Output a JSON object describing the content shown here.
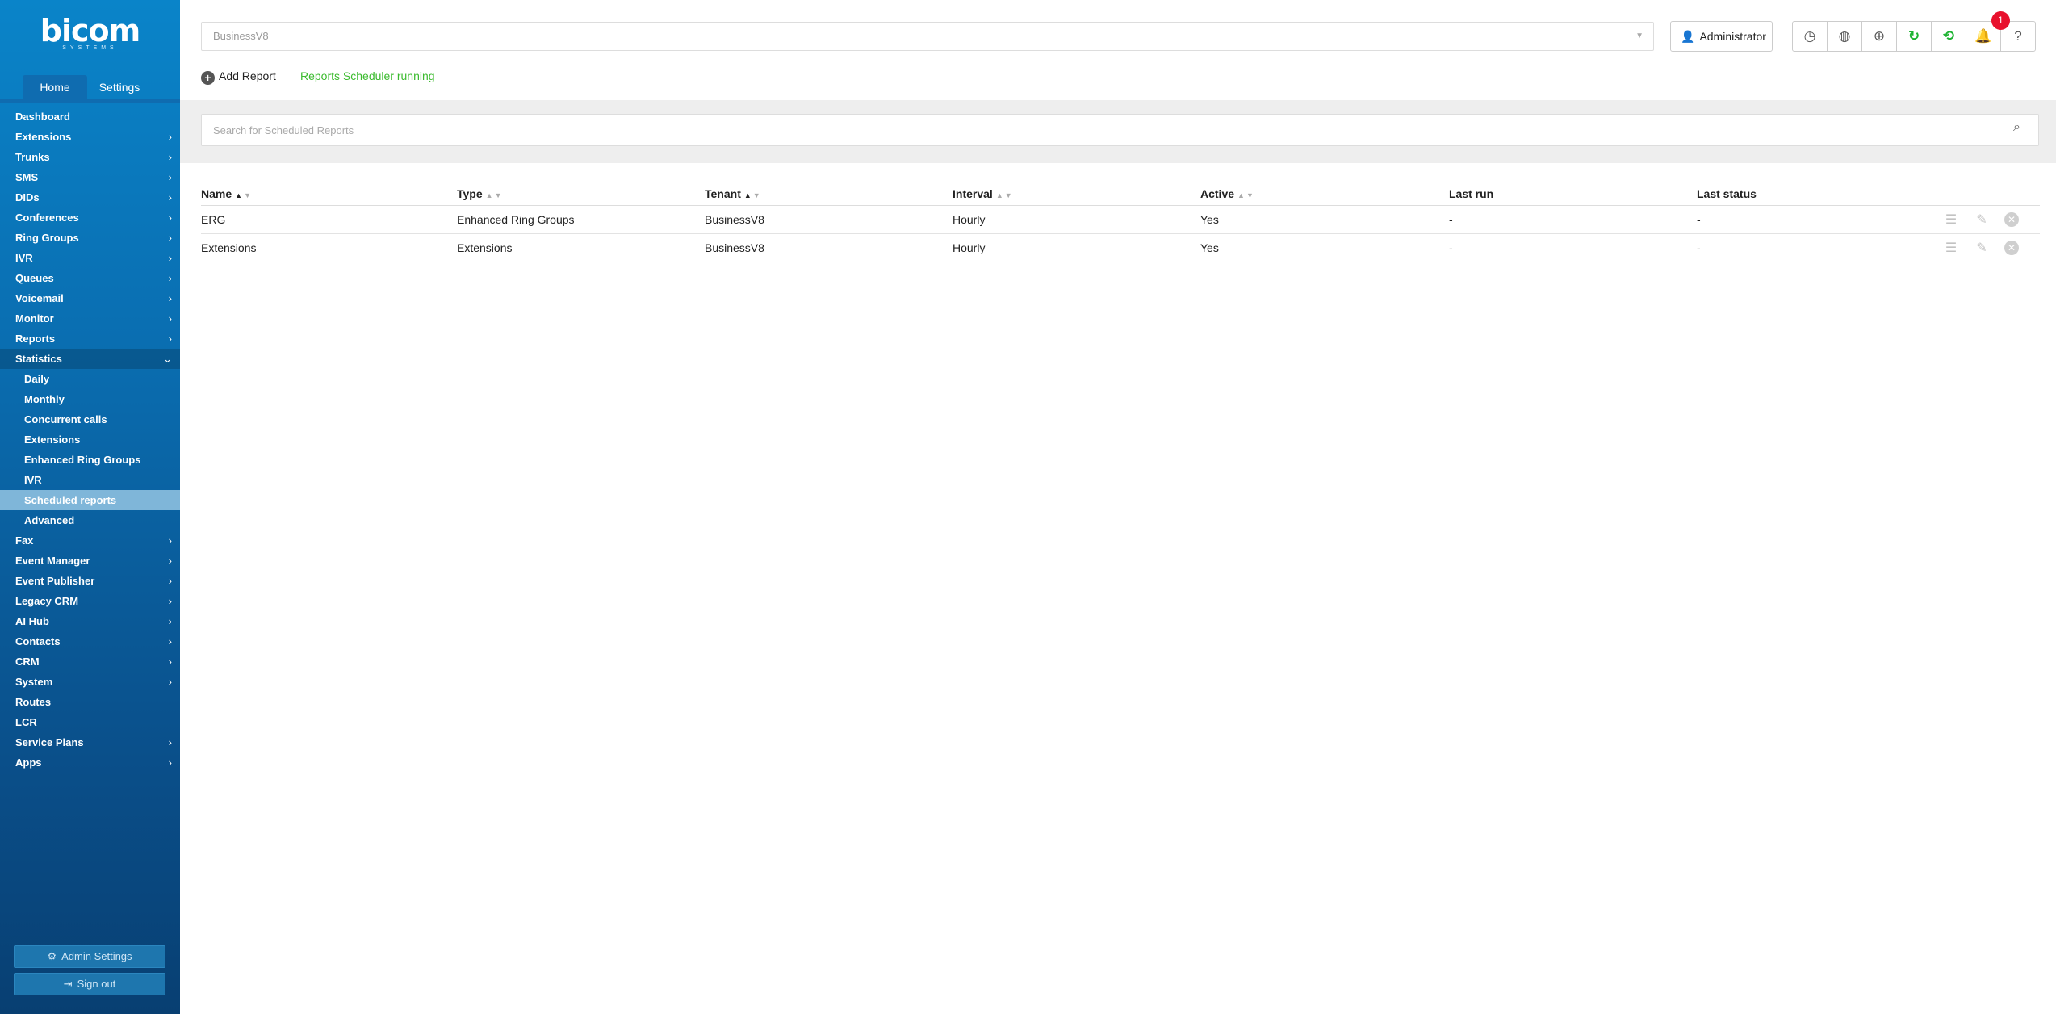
{
  "brand": {
    "name": "bicom",
    "sub": "SYSTEMS"
  },
  "sidebar": {
    "tabs": [
      {
        "label": "Home",
        "active": true
      },
      {
        "label": "Settings",
        "active": false
      }
    ],
    "menu": [
      {
        "label": "Dashboard",
        "has_children": false
      },
      {
        "label": "Extensions",
        "has_children": true
      },
      {
        "label": "Trunks",
        "has_children": true
      },
      {
        "label": "SMS",
        "has_children": true
      },
      {
        "label": "DIDs",
        "has_children": true
      },
      {
        "label": "Conferences",
        "has_children": true
      },
      {
        "label": "Ring Groups",
        "has_children": true
      },
      {
        "label": "IVR",
        "has_children": true
      },
      {
        "label": "Queues",
        "has_children": true
      },
      {
        "label": "Voicemail",
        "has_children": true
      },
      {
        "label": "Monitor",
        "has_children": true
      },
      {
        "label": "Reports",
        "has_children": true
      },
      {
        "label": "Statistics",
        "has_children": true,
        "open": true,
        "children": [
          {
            "label": "Daily"
          },
          {
            "label": "Monthly"
          },
          {
            "label": "Concurrent calls"
          },
          {
            "label": "Extensions"
          },
          {
            "label": "Enhanced Ring Groups"
          },
          {
            "label": "IVR"
          },
          {
            "label": "Scheduled reports",
            "active": true
          },
          {
            "label": "Advanced"
          }
        ]
      },
      {
        "label": "Fax",
        "has_children": true
      },
      {
        "label": "Event Manager",
        "has_children": true
      },
      {
        "label": "Event Publisher",
        "has_children": true
      },
      {
        "label": "Legacy CRM",
        "has_children": true
      },
      {
        "label": "AI Hub",
        "has_children": true
      },
      {
        "label": "Contacts",
        "has_children": true
      },
      {
        "label": "CRM",
        "has_children": true
      },
      {
        "label": "System",
        "has_children": true
      },
      {
        "label": "Routes",
        "has_children": false
      },
      {
        "label": "LCR",
        "has_children": false
      },
      {
        "label": "Service Plans",
        "has_children": true
      },
      {
        "label": "Apps",
        "has_children": true
      }
    ],
    "admin_settings_label": "Admin Settings",
    "sign_out_label": "Sign out"
  },
  "header": {
    "tenant_value": "BusinessV8",
    "user_label": "Administrator",
    "notification_count": "1",
    "icons": [
      "clock-icon",
      "globe-icon",
      "language-icon",
      "refresh-icon",
      "sync-icon",
      "bell-icon",
      "help-icon"
    ]
  },
  "actions": {
    "add_report_label": "Add Report",
    "scheduler_status": "Reports Scheduler running"
  },
  "search": {
    "placeholder": "Search for Scheduled Reports"
  },
  "table": {
    "columns": [
      {
        "label": "Name",
        "sortable": true,
        "sorted": "asc"
      },
      {
        "label": "Type",
        "sortable": true
      },
      {
        "label": "Tenant",
        "sortable": true,
        "sorted": "asc"
      },
      {
        "label": "Interval",
        "sortable": true
      },
      {
        "label": "Active",
        "sortable": true
      },
      {
        "label": "Last run",
        "sortable": false
      },
      {
        "label": "Last status",
        "sortable": false
      }
    ],
    "rows": [
      [
        "ERG",
        "Enhanced Ring Groups",
        "BusinessV8",
        "Hourly",
        "Yes",
        "-",
        "-"
      ],
      [
        "Extensions",
        "Extensions",
        "BusinessV8",
        "Hourly",
        "Yes",
        "-",
        "-"
      ]
    ]
  },
  "colors": {
    "sidebar_top": "#0a84c9",
    "sidebar_bottom": "#083f72",
    "active_sub": "#7fb6d9",
    "status_green": "#3cbb2f",
    "badge_red": "#e8112d"
  }
}
